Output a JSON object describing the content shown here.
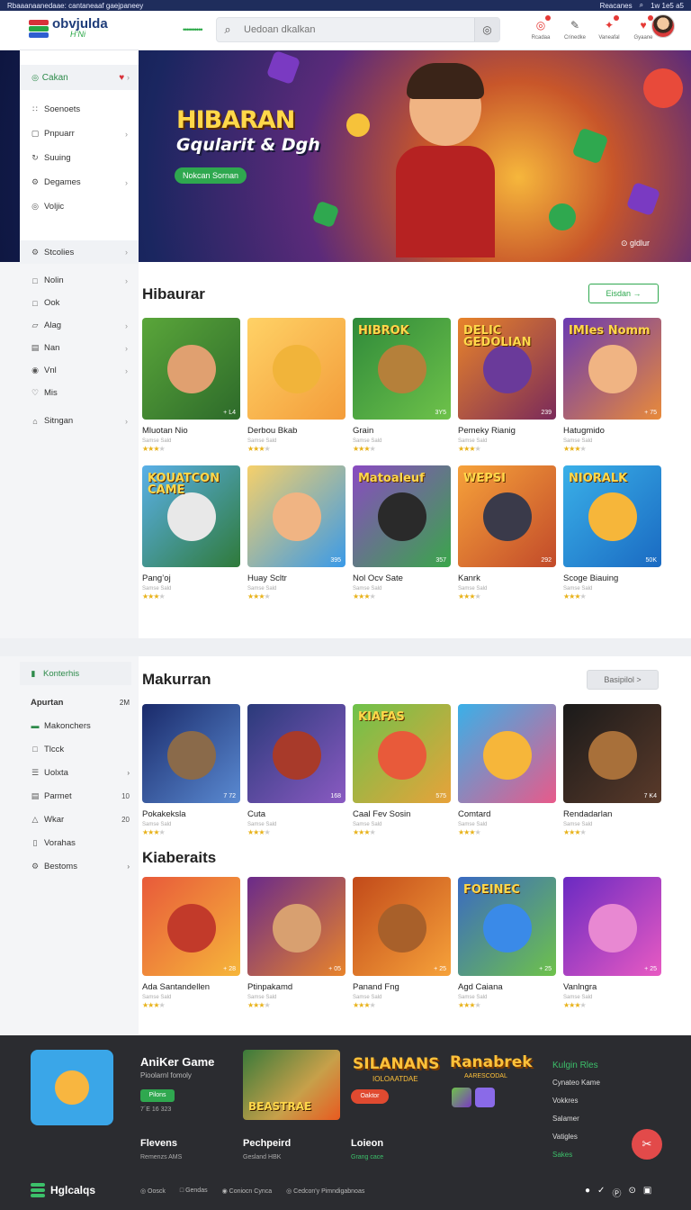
{
  "topstrip": {
    "left": "Rbaaanaanedaae: cantaneaaf gaejpaneey",
    "right": "Reacanes",
    "right2": "1w  1e5 a5"
  },
  "header": {
    "logo_title": "obvjulda",
    "logo_sub": "H’Ni",
    "dots": "••••••••••",
    "search_placeholder": "Uedoan dkalkan",
    "icons": [
      {
        "name": "notification-icon",
        "glyph": "◎",
        "label": "Rcadaa",
        "color": "#e53935"
      },
      {
        "name": "pencil-icon",
        "glyph": "✎",
        "label": "Crinedke",
        "color": "#555"
      },
      {
        "name": "gift-icon",
        "glyph": "✦",
        "label": "Vaneafal",
        "color": "#e53935"
      },
      {
        "name": "heart-icon",
        "glyph": "♥",
        "label": "Gyaane",
        "color": "#e53935"
      }
    ]
  },
  "hero": {
    "title": "HIBARAN",
    "subtitle": "Gqularit & Dgh",
    "button": "Nokcan Sornan",
    "caption": "⊙ gldlur"
  },
  "sidebar": {
    "active": "Cakan",
    "items": [
      {
        "icon": "grid-icon",
        "glyph": "∷",
        "label": "Soenoets",
        "chev": false
      },
      {
        "icon": "folder-icon",
        "glyph": "▢",
        "label": "Pnpuarr",
        "chev": true
      },
      {
        "icon": "refresh-icon",
        "glyph": "↻",
        "label": "Suuing",
        "chev": false
      },
      {
        "icon": "settings-icon",
        "glyph": "⚙",
        "label": "Degames",
        "chev": true
      },
      {
        "icon": "circle-icon",
        "glyph": "◎",
        "label": "Voljic",
        "chev": false
      }
    ]
  },
  "leftnav": [
    {
      "icon": "gear-icon",
      "glyph": "⚙",
      "label": "Stcolies",
      "chev": true
    },
    {
      "icon": "document-icon",
      "glyph": "□",
      "label": "Nolin",
      "chev": true
    },
    {
      "icon": "book-icon",
      "glyph": "□",
      "label": "Ook",
      "chev": false
    },
    {
      "icon": "folder-icon",
      "glyph": "▱",
      "label": "Alag",
      "chev": true
    },
    {
      "icon": "cart-icon",
      "glyph": "▤",
      "label": "Nan",
      "chev": true
    },
    {
      "icon": "location-icon",
      "glyph": "◉",
      "label": "Vnl",
      "chev": true
    },
    {
      "icon": "bell-icon",
      "glyph": "♡",
      "label": "Mis",
      "chev": false
    },
    {
      "icon": "gift-icon",
      "glyph": "⌂",
      "label": "Sitngan",
      "chev": true
    }
  ],
  "section1": {
    "title": "Hibaurar",
    "button": "Eisdan  →",
    "games": [
      {
        "name": "Mluotan Nio",
        "meta": "Samse  Sald",
        "badge": "+ L4",
        "stars": 3,
        "bg": "linear-gradient(135deg,#5aa63a,#2d6a2a)",
        "chr": "#e0a070",
        "ttl": ""
      },
      {
        "name": "Derbou Bkab",
        "meta": "Samse  Sald",
        "badge": "",
        "stars": 3,
        "bg": "linear-gradient(135deg,#ffd266,#f39c3a)",
        "chr": "#f1b43a",
        "ttl": ""
      },
      {
        "name": "Grain",
        "meta": "Samse  Sald",
        "badge": "3Y5",
        "stars": 3,
        "bg": "linear-gradient(135deg,#2f8a3a,#6ec24a)",
        "chr": "#b5803a",
        "ttl": "HIBROK"
      },
      {
        "name": "Pemeky Rianig",
        "meta": "Samse  Sald",
        "badge": "239",
        "stars": 3,
        "bg": "linear-gradient(135deg,#e8842a,#7a2a5a)",
        "chr": "#6a3a9a",
        "ttl": "DELIC GEDOLIAN"
      },
      {
        "name": "Hatugmido",
        "meta": "Samse  Sald",
        "badge": "+ 75",
        "stars": 3,
        "bg": "linear-gradient(135deg,#6a3ab2,#e88a3a)",
        "chr": "#f0b483",
        "ttl": "IMIes Nomm"
      },
      {
        "name": "Pang’oj",
        "meta": "Samse  Sald",
        "badge": "",
        "stars": 3,
        "bg": "linear-gradient(135deg,#5ab0e8,#2f7a3a)",
        "chr": "#e8e8e8",
        "ttl": "KOUATCON CAME"
      },
      {
        "name": "Huay Scltr",
        "meta": "Samse  Sald",
        "badge": "395",
        "stars": 3,
        "bg": "linear-gradient(135deg,#f6d06a,#3a9ae8)",
        "chr": "#f0b483",
        "ttl": ""
      },
      {
        "name": "Nol Ocv Sate",
        "meta": "Samse  Sald",
        "badge": "357",
        "stars": 3,
        "bg": "linear-gradient(135deg,#8a4ac2,#3aa64a)",
        "chr": "#2a2a2a",
        "ttl": "Matoaleuf"
      },
      {
        "name": "Kanrk",
        "meta": "Samse  Sald",
        "badge": "292",
        "stars": 3,
        "bg": "linear-gradient(135deg,#f6a23a,#c24a2a)",
        "chr": "#3a3a4a",
        "ttl": "WEPSI"
      },
      {
        "name": "Scoge Biauing",
        "meta": "Samse  Sald",
        "badge": "50K",
        "stars": 3,
        "bg": "linear-gradient(135deg,#3ab0e8,#1a6ac2)",
        "chr": "#f6b63a",
        "ttl": "NIORALK"
      }
    ]
  },
  "section2_nav": {
    "active": "Konterhis",
    "header_label": "Apurtan",
    "header_count": "2M",
    "items": [
      {
        "icon": "gamepad-icon",
        "glyph": "▬",
        "label": "Makonchers",
        "right": ""
      },
      {
        "icon": "document-icon",
        "glyph": "□",
        "label": "Tlcck",
        "right": ""
      },
      {
        "icon": "list-icon",
        "glyph": "☰",
        "label": "Uolxta",
        "right": "›"
      },
      {
        "icon": "calendar-icon",
        "glyph": "▤",
        "label": "Parmet",
        "right": "10"
      },
      {
        "icon": "triangle-icon",
        "glyph": "△",
        "label": "Wkar",
        "right": "20"
      },
      {
        "icon": "bookmark-icon",
        "glyph": "▯",
        "label": "Vorahas",
        "right": ""
      },
      {
        "icon": "settings-icon",
        "glyph": "⚙",
        "label": "Bestoms",
        "right": "›"
      }
    ]
  },
  "section2": {
    "title": "Makurran",
    "button": "Basipilol   >",
    "games": [
      {
        "name": "Pokakeksla",
        "meta": "Samse  Sald",
        "badge": "7 72",
        "stars": 3,
        "bg": "linear-gradient(135deg,#1a2a6a,#5a8ad2)",
        "chr": "#8a6a4a",
        "ttl": ""
      },
      {
        "name": "Cuta",
        "meta": "Samse  Sald",
        "badge": "168",
        "stars": 3,
        "bg": "linear-gradient(135deg,#2a3a7a,#8a5ac2)",
        "chr": "#a83a2a",
        "ttl": ""
      },
      {
        "name": "Caal Fev Sosin",
        "meta": "Samse  Sald",
        "badge": "575",
        "stars": 3,
        "bg": "linear-gradient(135deg,#6ec24a,#e8a23a)",
        "chr": "#e85a3a",
        "ttl": "KIAFAS"
      },
      {
        "name": "Comtard",
        "meta": "Samse  Sald",
        "badge": "",
        "stars": 3,
        "bg": "linear-gradient(135deg,#3ab0e8,#e85a8a)",
        "chr": "#f6b63a",
        "ttl": ""
      },
      {
        "name": "Rendadarlan",
        "meta": "Samse  Sald",
        "badge": "7 K4",
        "stars": 3,
        "bg": "linear-gradient(135deg,#1a1a1a,#5a3a2a)",
        "chr": "#a8703a",
        "ttl": ""
      }
    ]
  },
  "section3": {
    "title": "Kiaberaits",
    "games": [
      {
        "name": "Ada Santandellen",
        "meta": "Samse  Sald",
        "badge": "+ 28",
        "stars": 3,
        "bg": "linear-gradient(135deg,#e85a3a,#f6b63a)",
        "chr": "#c23a2a",
        "ttl": ""
      },
      {
        "name": "Ptinpakamd",
        "meta": "Samse  Sald",
        "badge": "+ 05",
        "stars": 3,
        "bg": "linear-gradient(135deg,#6a2a8a,#e8842a)",
        "chr": "#d8a070",
        "ttl": ""
      },
      {
        "name": "Panand Fng",
        "meta": "Samse  Sald",
        "badge": "+ 25",
        "stars": 3,
        "bg": "linear-gradient(135deg,#c24a1a,#f6a23a)",
        "chr": "#a8602a",
        "ttl": ""
      },
      {
        "name": "Agd Caiana",
        "meta": "Samse  Sald",
        "badge": "+ 25",
        "stars": 3,
        "bg": "linear-gradient(135deg,#3a6ac2,#6ec24a)",
        "chr": "#3a8ae8",
        "ttl": "FOEINEC"
      },
      {
        "name": "Vanlngra",
        "meta": "Samse  Sald",
        "badge": "+ 25",
        "stars": 3,
        "bg": "linear-gradient(135deg,#6a2ac2,#e85ac2)",
        "chr": "#e888d2",
        "ttl": ""
      }
    ]
  },
  "footer": {
    "title": "AniKer Game",
    "sub": "Pioolarnl fomoly",
    "pill": "Pilons",
    "num": "7´E  16 323",
    "img_text": "BEASTRAE",
    "logo1": "SILANANS",
    "logo1_sub": "IOLOAATDAE",
    "red_btn": "Oaktor",
    "logo2": "Ranabrek",
    "logo2_sub": "AARESCODAL",
    "links_head": "Kulgin Rles",
    "links": [
      "Cynateo Kame",
      "Vokkres",
      "Salamer",
      "Vatigles"
    ],
    "links_green": "Sakes",
    "cols": [
      {
        "h": "Flevens",
        "s": "Remenzs  AMS",
        "green": false
      },
      {
        "h": "Pechpeird",
        "s": "Gesland HBK",
        "green": false
      },
      {
        "h": "Loieon",
        "s": "Grang cace",
        "green": true
      }
    ],
    "fab": "✂",
    "brand": "Hglcalqs",
    "bottom": [
      "◎ Oosck",
      "□ Gendas",
      "◉ Coniocn Cynca",
      "◎ Cedcon'y Pimndigabnoas"
    ],
    "social": [
      "●",
      "✓",
      "Ⓟ",
      "⊙",
      "▣"
    ]
  }
}
